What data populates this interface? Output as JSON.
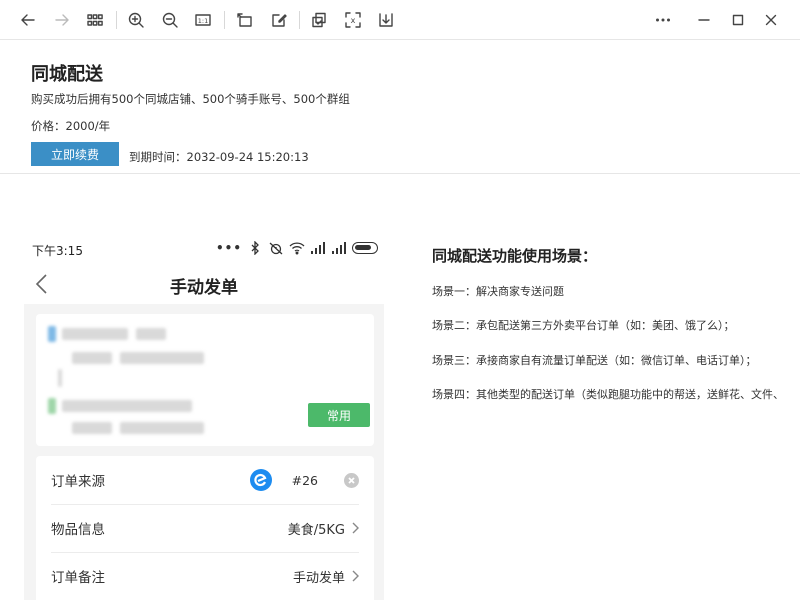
{
  "toolbar": {
    "icons": [
      "back-icon",
      "forward-icon",
      "thumbnails-icon",
      "zoom-in-icon",
      "zoom-out-icon",
      "actual-size-icon",
      "rotate-icon",
      "edit-icon",
      "copy-icon",
      "text-recognize-icon",
      "download-icon",
      "more-icon",
      "minimize-icon",
      "maximize-icon",
      "close-icon"
    ],
    "actual_size_label": "1:1",
    "ocr_label": "x"
  },
  "header": {
    "title": "同城配送",
    "description": "购买成功后拥有500个同城店铺、500个骑手账号、500个群组",
    "price": "价格：2000/年",
    "renew_button": "立即续费",
    "expire": "到期时间：2032-09-24 15:20:13"
  },
  "phone": {
    "status_time": "下午3:15",
    "nav_title": "手动发单",
    "use_button": "常用",
    "rows": [
      {
        "label": "订单来源",
        "value": "#26"
      },
      {
        "label": "物品信息",
        "value": "美食/5KG"
      },
      {
        "label": "订单备注",
        "value": "手动发单"
      }
    ]
  },
  "scenarios": {
    "title": "同城配送功能使用场景：",
    "items": [
      "场景一：解决商家专送问题",
      "场景二：承包配送第三方外卖平台订单（如：美团、饿了么）；",
      "场景三：承接商家自有流量订单配送（如：微信订单、电话订单）；",
      "场景四：其他类型的配送订单（类似跑腿功能中的帮送，送鲜花、文件、"
    ]
  },
  "colors": {
    "renew_button": "#3b8fc6",
    "use_button": "#4cb96a",
    "source_logo": "#1d8cf0"
  }
}
